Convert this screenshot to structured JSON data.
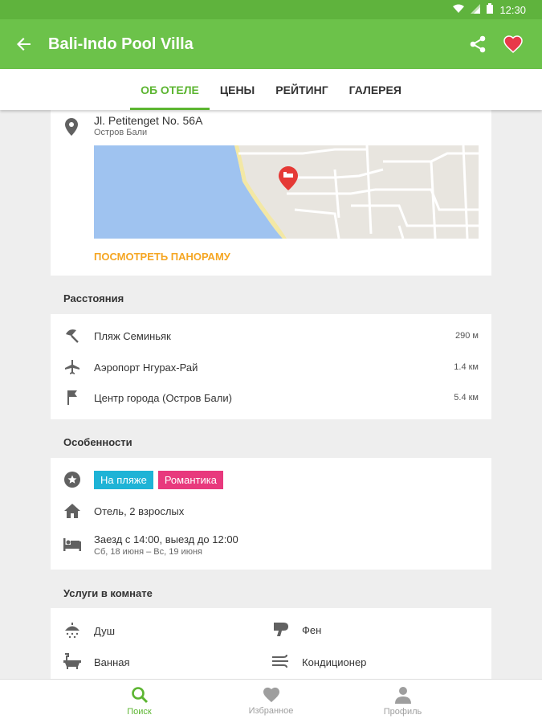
{
  "status_bar": {
    "time": "12:30"
  },
  "app_bar": {
    "title": "Bali-Indo Pool Villa"
  },
  "tabs": [
    {
      "label": "ОБ ОТЕЛЕ",
      "active": true
    },
    {
      "label": "ЦЕНЫ",
      "active": false
    },
    {
      "label": "РЕЙТИНГ",
      "active": false
    },
    {
      "label": "ГАЛЕРЕЯ",
      "active": false
    }
  ],
  "location": {
    "address": "Jl. Petitenget No. 56A",
    "region": "Остров Бали",
    "panorama_label": "ПОСМОТРЕТЬ ПАНОРАМУ"
  },
  "distances": {
    "title": "Расстояния",
    "items": [
      {
        "icon": "beach-umbrella-icon",
        "label": "Пляж Семиньяк",
        "value": "290 м"
      },
      {
        "icon": "airplane-icon",
        "label": "Аэропорт Нгурах-Рай",
        "value": "1.4 км"
      },
      {
        "icon": "flag-icon",
        "label": "Центр города (Остров Бали)",
        "value": "5.4 км"
      }
    ]
  },
  "features": {
    "title": "Особенности",
    "tags": [
      {
        "label": "На пляже",
        "color": "#1eb3d6"
      },
      {
        "label": "Романтика",
        "color": "#e8397d"
      }
    ],
    "type_label": "Отель, 2 взрослых",
    "checkin_label": "Заезд с 14:00, выезд до 12:00",
    "dates_label": "Сб, 18 июня – Вс, 19 июня"
  },
  "room_services": {
    "title": "Услуги в комнате",
    "items": [
      {
        "icon": "shower-icon",
        "label": "Душ"
      },
      {
        "icon": "hairdryer-icon",
        "label": "Фен"
      },
      {
        "icon": "bathtub-icon",
        "label": "Ванная"
      },
      {
        "icon": "air-conditioner-icon",
        "label": "Кондиционер"
      }
    ]
  },
  "bottom_nav": [
    {
      "label": "Поиск",
      "icon": "search-icon",
      "active": true
    },
    {
      "label": "Избранное",
      "icon": "heart-icon",
      "active": false
    },
    {
      "label": "Профиль",
      "icon": "person-icon",
      "active": false
    }
  ],
  "colors": {
    "primary": "#6cc24a",
    "accent": "#5cb531",
    "link": "#f5a623",
    "favorite": "#e8394a"
  }
}
